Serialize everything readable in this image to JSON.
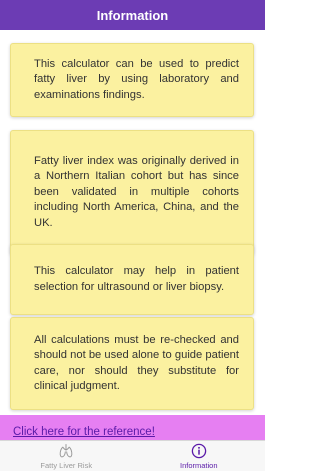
{
  "header": {
    "title": "Information"
  },
  "cards": [
    {
      "text": "This calculator can be used to predict fatty liver by using laboratory and examinations findings."
    },
    {
      "text": "Fatty liver index was originally derived in a Northern Italian cohort but has since been validated in multiple cohorts including North America, China, and the UK."
    },
    {
      "text": "This calculator may help in patient selection for ultrasound or liver biopsy."
    },
    {
      "text": "All calculations must be re-checked and should not be used alone to guide patient care, nor should they substitute for clinical judgment."
    }
  ],
  "reference": {
    "link_text": "Click here for the reference!"
  },
  "tabs": [
    {
      "label": "Fatty Liver Risk",
      "icon": "lungs-icon",
      "active": false
    },
    {
      "label": "Information",
      "icon": "info-icon",
      "active": true
    }
  ],
  "colors": {
    "header_bg": "#6c3cb4",
    "card_bg": "#fbf1a0",
    "reference_bg": "#e67ff2",
    "accent": "#5a1aa8"
  }
}
